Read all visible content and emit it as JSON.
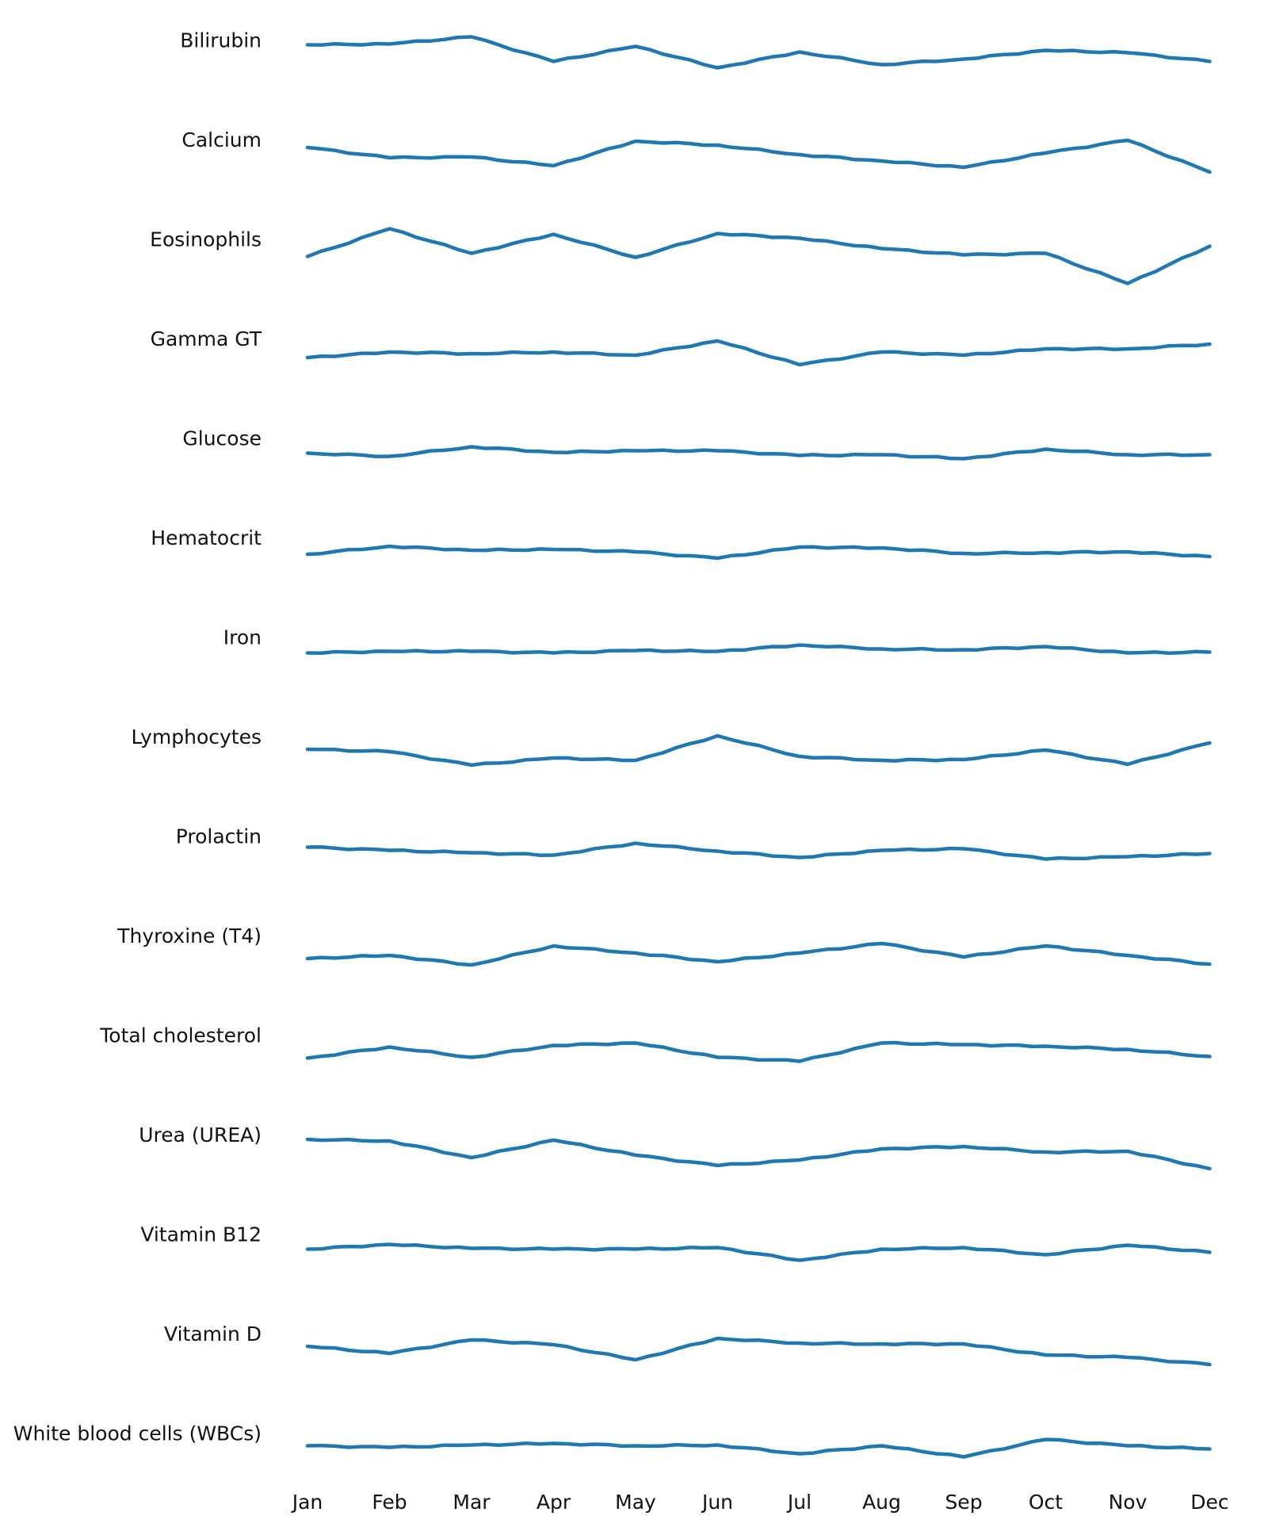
{
  "chart_data": {
    "type": "line",
    "title": "",
    "xlabel": "",
    "ylabel": "",
    "layout": "small-multiples (one row per analyte, shared month axis, no y-axis)",
    "value_units": "relative level (no y-axis scale shown; higher = line drawn higher)",
    "grid": false,
    "legend": "none",
    "line_color": "#1f77b4",
    "x": [
      "Jan",
      "Feb",
      "Mar",
      "Apr",
      "May",
      "Jun",
      "Jul",
      "Aug",
      "Sep",
      "Oct",
      "Nov",
      "Dec"
    ],
    "series": [
      {
        "name": "Bilirubin",
        "values": [
          -6,
          -5,
          4,
          -27,
          -8,
          -35,
          -15,
          -31,
          -24,
          -13,
          -16,
          -27
        ]
      },
      {
        "name": "Calcium",
        "values": [
          -10,
          -23,
          -22,
          -33,
          -2,
          -7,
          -19,
          -27,
          -35,
          -17,
          -1,
          -41
        ]
      },
      {
        "name": "Eosinophils",
        "values": [
          -22,
          13,
          -18,
          6,
          -23,
          7,
          1,
          -12,
          -20,
          -18,
          -56,
          -9
        ]
      },
      {
        "name": "Gamma GT",
        "values": [
          -24,
          -17,
          -19,
          -17,
          -21,
          -3,
          -33,
          -17,
          -21,
          -13,
          -13,
          -7
        ]
      },
      {
        "name": "Glucose",
        "values": [
          -19,
          -23,
          -11,
          -18,
          -16,
          -16,
          -22,
          -21,
          -26,
          -14,
          -21,
          -21
        ]
      },
      {
        "name": "Hematocrit",
        "values": [
          -21,
          -11,
          -16,
          -15,
          -18,
          -26,
          -12,
          -13,
          -20,
          -19,
          -18,
          -24
        ]
      },
      {
        "name": "Iron",
        "values": [
          -20,
          -18,
          -18,
          -20,
          -17,
          -18,
          -10,
          -15,
          -16,
          -12,
          -20,
          -19
        ]
      },
      {
        "name": "Lymphocytes",
        "values": [
          -16,
          -19,
          -36,
          -27,
          -30,
          1,
          -25,
          -30,
          -29,
          -17,
          -35,
          -8
        ]
      },
      {
        "name": "Prolactin",
        "values": [
          -14,
          -18,
          -21,
          -24,
          -9,
          -19,
          -27,
          -18,
          -16,
          -29,
          -26,
          -22
        ]
      },
      {
        "name": "Thyroxine (T4)",
        "values": [
          -29,
          -25,
          -37,
          -13,
          -22,
          -33,
          -22,
          -10,
          -27,
          -13,
          -25,
          -36
        ]
      },
      {
        "name": "Total cholesterol",
        "values": [
          -29,
          -15,
          -28,
          -13,
          -10,
          -28,
          -33,
          -10,
          -12,
          -14,
          -18,
          -27
        ]
      },
      {
        "name": "Urea (UREA)",
        "values": [
          -6,
          -8,
          -29,
          -7,
          -26,
          -39,
          -32,
          -18,
          -15,
          -22,
          -21,
          -43
        ]
      },
      {
        "name": "Vitamin B12",
        "values": [
          -19,
          -13,
          -18,
          -19,
          -19,
          -17,
          -33,
          -19,
          -17,
          -26,
          -14,
          -23
        ]
      },
      {
        "name": "Vitamin D",
        "values": [
          -16,
          -25,
          -8,
          -14,
          -33,
          -6,
          -12,
          -13,
          -13,
          -27,
          -30,
          -39
        ]
      },
      {
        "name": "White blood cells (WBCs)",
        "values": [
          -16,
          -18,
          -15,
          -13,
          -16,
          -15,
          -26,
          -16,
          -30,
          -8,
          -16,
          -20
        ]
      }
    ]
  }
}
